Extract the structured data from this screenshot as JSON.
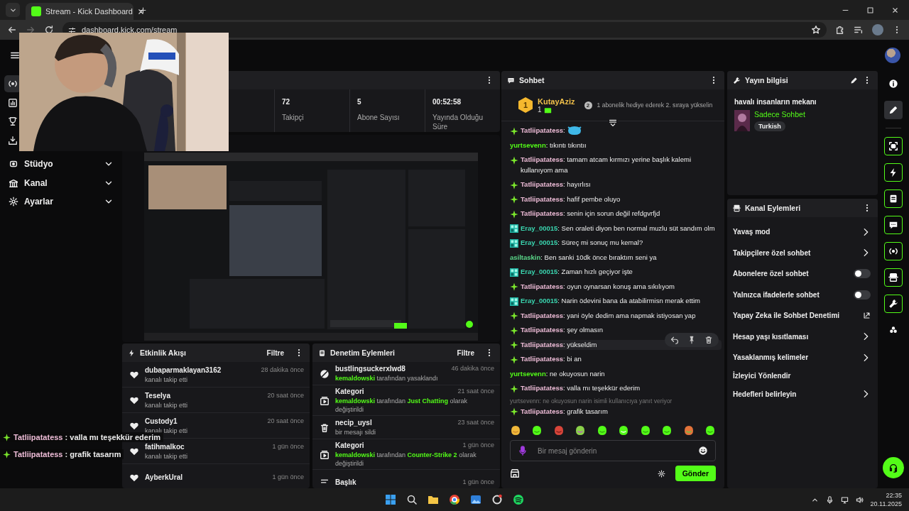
{
  "browser": {
    "tab_title": "Stream - Kick Dashboard",
    "url": "dashboard.kick.com/stream"
  },
  "sidebar": {
    "nav_icons": [
      {
        "selected": true
      },
      {
        "selected": false
      },
      {
        "selected": false
      },
      {
        "selected": false
      }
    ],
    "menu": [
      {
        "label": "Stüdyo",
        "expanded": false
      },
      {
        "label": "Kanal",
        "expanded": false
      },
      {
        "label": "Ayarlar",
        "expanded": false
      }
    ]
  },
  "stats": [
    {
      "value": "72",
      "label": "Takipçi"
    },
    {
      "value": "5",
      "label": "Abone Sayısı"
    },
    {
      "value": "00:52:58",
      "label": "Yayında Olduğu Süre"
    }
  ],
  "activity_feed": {
    "title": "Etkinlik Akışı",
    "filter": "Filtre",
    "events": [
      {
        "user": "dubaparmaklayan3162",
        "time": "28 dakika önce",
        "detail": "kanalı takip etti"
      },
      {
        "user": "Teselya",
        "time": "20 saat önce",
        "detail": "kanalı takip etti"
      },
      {
        "user": "Custody1",
        "time": "20 saat önce",
        "detail": "kanalı takip etti"
      },
      {
        "user": "fatihmalkoc",
        "time": "1 gün önce",
        "detail": "kanalı takip etti"
      },
      {
        "user": "AyberkUral",
        "time": "1 gün önce"
      }
    ]
  },
  "moderation": {
    "title": "Denetim Eylemleri",
    "filter": "Filtre",
    "actions": [
      {
        "kind": "ban",
        "title": "bustlingsuckerxlwd8",
        "time": "46 dakika önce",
        "detail": [
          {
            "text": "kemaldowski",
            "highlight": true
          },
          {
            "text": "tarafından yasaklandı",
            "highlight": false
          }
        ]
      },
      {
        "kind": "category",
        "title": "Kategori",
        "time": "21 saat önce",
        "detail": [
          {
            "text": "kemaldowski",
            "highlight": true
          },
          {
            "text": "tarafından",
            "highlight": false
          },
          {
            "text": "Just Chatting",
            "highlight": true
          },
          {
            "text": "olarak değiştirildi",
            "highlight": false
          }
        ]
      },
      {
        "kind": "delete",
        "title": "necip_uysl",
        "time": "23 saat önce",
        "detail": [
          {
            "text": "bir mesajı sildi",
            "highlight": false
          }
        ]
      },
      {
        "kind": "category",
        "title": "Kategori",
        "time": "1 gün önce",
        "detail": [
          {
            "text": "kemaldowski",
            "highlight": true
          },
          {
            "text": "tarafından",
            "highlight": false
          },
          {
            "text": "Counter-Strike 2",
            "highlight": true
          },
          {
            "text": "olarak değiştirildi",
            "highlight": false
          }
        ]
      },
      {
        "kind": "title",
        "title": "Başlık",
        "time": "1 gün önce"
      }
    ]
  },
  "chat": {
    "title": "Sohbet",
    "leader": {
      "rank": "1",
      "name": "KutayAziz",
      "count": "1",
      "next_rank": "2",
      "hint": "1 abonelik hediye ederek 2. sıraya yükselin"
    },
    "messages": [
      {
        "kind": "sparkle",
        "user": "Tatliipatatess",
        "color": "#efbdd8",
        "text": ":",
        "emote": true,
        "hovered": false
      },
      {
        "kind": "plain",
        "user": "yurtsevenn",
        "color": "#53fc18",
        "text": ": tıkıntı tıkıntıı",
        "emote": false,
        "hovered": false
      },
      {
        "kind": "sparkle",
        "user": "Tatliipatatess",
        "color": "#efbdd8",
        "text": ": tamam atcam kırmızı yerine başlık kalemi kullanıyom ama",
        "emote": false,
        "hovered": false
      },
      {
        "kind": "sparkle",
        "user": "Tatliipatatess",
        "color": "#efbdd8",
        "text": ": hayırlısı",
        "emote": false,
        "hovered": false
      },
      {
        "kind": "sparkle",
        "user": "Tatliipatatess",
        "color": "#efbdd8",
        "text": ": hafif pembe oluyo",
        "emote": false,
        "hovered": false
      },
      {
        "kind": "sparkle",
        "user": "Tatliipatatess",
        "color": "#efbdd8",
        "text": ": senin için sorun değil refdgvrfjd",
        "emote": false,
        "hovered": false
      },
      {
        "kind": "pixel",
        "user": "Eray_00015",
        "color": "#3ad6b0",
        "text": ": Sen oraleti diyon ben normal muzlu süt sandım olm",
        "emote": false,
        "hovered": false
      },
      {
        "kind": "pixel",
        "user": "Eray_00015",
        "color": "#3ad6b0",
        "text": ": Süreç mi sonuç mu kemal?",
        "emote": false,
        "hovered": false
      },
      {
        "kind": "plain",
        "user": "asiltaskin",
        "color": "#5bd98a",
        "text": ": Ben sanki 10dk önce bıraktım seni ya",
        "emote": false,
        "hovered": false
      },
      {
        "kind": "pixel",
        "user": "Eray_00015",
        "color": "#3ad6b0",
        "text": ": Zaman hızlı geçiyor işte",
        "emote": false,
        "hovered": false
      },
      {
        "kind": "sparkle",
        "user": "Tatliipatatess",
        "color": "#efbdd8",
        "text": ": oyun oynarsan konuş ama sıkılıyom",
        "emote": false,
        "hovered": false
      },
      {
        "kind": "pixel",
        "user": "Eray_00015",
        "color": "#3ad6b0",
        "text": ": Narin ödevini bana da atabilirmisn merak ettim",
        "emote": false,
        "hovered": false
      },
      {
        "kind": "sparkle",
        "user": "Tatliipatatess",
        "color": "#efbdd8",
        "text": ": yani öyle dedim ama napmak istiyosan yap",
        "emote": false,
        "hovered": false
      },
      {
        "kind": "sparkle",
        "user": "Tatliipatatess",
        "color": "#efbdd8",
        "text": ": şey olmasın",
        "emote": false,
        "hovered": false
      },
      {
        "kind": "sparkle",
        "user": "Tatliipatatess",
        "color": "#efbdd8",
        "text": ": yükseldim",
        "emote": false,
        "hovered": true
      },
      {
        "kind": "sparkle",
        "user": "Tatliipatatess",
        "color": "#efbdd8",
        "text": ": bi an",
        "emote": false,
        "hovered": false
      },
      {
        "kind": "plain",
        "user": "yurtsevenn",
        "color": "#53fc18",
        "text": ": ne okuyosun narin",
        "emote": false,
        "hovered": false
      },
      {
        "kind": "sparkle",
        "user": "Tatliipatatess",
        "color": "#efbdd8",
        "text": ": valla mı teşekkür ederim",
        "emote": false,
        "hovered": false
      },
      {
        "kind": "sparkle",
        "user": "Tatliipatatess",
        "color": "#efbdd8",
        "text": ": grafik tasarım",
        "emote": false,
        "hovered": false,
        "reply_to": "yurtsevenn: ne okuyosun narin isimli kullanıcıya yanıt veriyor"
      }
    ],
    "input": {
      "placeholder": "Bir mesaj gönderin"
    },
    "send": "Gönder"
  },
  "stream_info": {
    "title": "Yayın bilgisi",
    "stream_title": "havalı insanların mekanı",
    "category": "Sadece Sohbet",
    "tags": [
      "Turkish"
    ]
  },
  "channel_actions": {
    "title": "Kanal Eylemleri",
    "items": [
      {
        "kind": "link",
        "label": "Yavaş mod"
      },
      {
        "kind": "link",
        "label": "Takipçilere özel sohbet"
      },
      {
        "kind": "toggle",
        "label": "Abonelere özel sohbet",
        "on": false
      },
      {
        "kind": "toggle",
        "label": "Yalnızca ifadelerle sohbet",
        "on": false
      },
      {
        "kind": "external",
        "label": "Yapay Zeka ile Sohbet Denetimi"
      },
      {
        "kind": "link",
        "label": "Hesap yaşı kısıtlaması"
      },
      {
        "kind": "link",
        "label": "Yasaklanmış kelimeler"
      },
      {
        "kind": "plain",
        "label": "İzleyici Yönlendir"
      },
      {
        "kind": "link",
        "label": "Hedefleri belirleyin"
      }
    ]
  },
  "rail": [
    {
      "kind": "plain",
      "selected": false
    },
    {
      "kind": "plain",
      "selected": true
    },
    {
      "kind": "outlined",
      "selected": false
    },
    {
      "kind": "outlined",
      "selected": false
    },
    {
      "kind": "outlined",
      "selected": false
    },
    {
      "kind": "outlined",
      "selected": false
    },
    {
      "kind": "outlined",
      "selected": false
    },
    {
      "kind": "outlined",
      "selected": false
    },
    {
      "kind": "outlined",
      "selected": false
    },
    {
      "kind": "plain",
      "selected": false
    }
  ],
  "stream_overlay": [
    {
      "user": "Tatliipatatess",
      "text": ": valla mı teşekkür ederim"
    },
    {
      "user": "Tatliipatatess",
      "text": ": grafik tasarım"
    }
  ],
  "taskbar": {
    "time": "22:35",
    "date": "20.11.2025"
  }
}
